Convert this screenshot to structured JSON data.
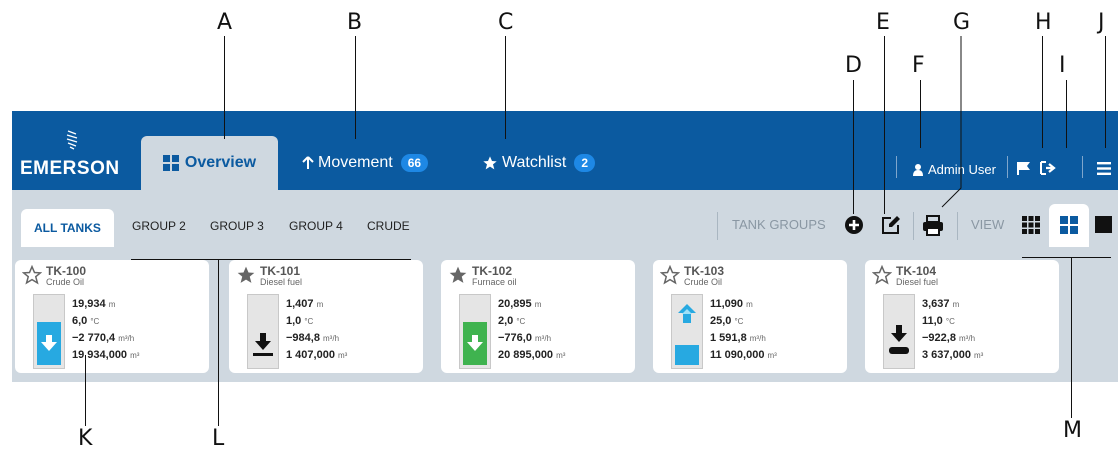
{
  "callouts": {
    "a": "A",
    "b": "B",
    "c": "C",
    "d": "D",
    "e": "E",
    "f": "F",
    "g": "G",
    "h": "H",
    "i": "I",
    "j": "J",
    "k": "K",
    "l": "L",
    "m": "M"
  },
  "header": {
    "logo": "EMERSON",
    "tabs": [
      {
        "label": "Overview",
        "icon": "grid-icon",
        "active": true
      },
      {
        "label": "Movement",
        "icon": "arrow-up-icon",
        "badge": "66"
      },
      {
        "label": "Watchlist",
        "icon": "star-icon",
        "badge": "2"
      }
    ],
    "user": "Admin User",
    "color_bar": "#0b5aa0"
  },
  "groups": {
    "items": [
      "ALL TANKS",
      "GROUP 2",
      "GROUP 3",
      "GROUP 4",
      "CRUDE"
    ],
    "tank_groups_label": "TANK GROUPS",
    "view_label": "VIEW"
  },
  "tanks": [
    {
      "id": "TK-100",
      "product": "Crude Oil",
      "level": "19,934",
      "temp": "6,0",
      "flow": "−2 770,4",
      "volume": "19 934,000",
      "level_unit": "m",
      "temp_unit": "°C",
      "flow_unit": "m³/h",
      "vol_unit": "m³",
      "favorite": false,
      "status": "filling-down"
    },
    {
      "id": "TK-101",
      "product": "Diesel fuel",
      "level": "1,407",
      "temp": "1,0",
      "flow": "−984,8",
      "volume": "1 407,000",
      "level_unit": "m",
      "temp_unit": "°C",
      "flow_unit": "m³/h",
      "vol_unit": "m³",
      "favorite": true,
      "status": "emptying"
    },
    {
      "id": "TK-102",
      "product": "Furnace oil",
      "level": "20,895",
      "temp": "2,0",
      "flow": "−776,0",
      "volume": "20 895,000",
      "level_unit": "m",
      "temp_unit": "°C",
      "flow_unit": "m³/h",
      "vol_unit": "m³",
      "favorite": true,
      "status": "filling-down-green"
    },
    {
      "id": "TK-103",
      "product": "Crude Oil",
      "level": "11,090",
      "temp": "25,0",
      "flow": "1 591,8",
      "volume": "11 090,000",
      "level_unit": "m",
      "temp_unit": "°C",
      "flow_unit": "m³/h",
      "vol_unit": "m³",
      "favorite": false,
      "status": "rising"
    },
    {
      "id": "TK-104",
      "product": "Diesel fuel",
      "level": "3,637",
      "temp": "11,0",
      "flow": "−922,8",
      "volume": "3 637,000",
      "level_unit": "m",
      "temp_unit": "°C",
      "flow_unit": "m³/h",
      "vol_unit": "m³",
      "favorite": false,
      "status": "emptying"
    }
  ]
}
